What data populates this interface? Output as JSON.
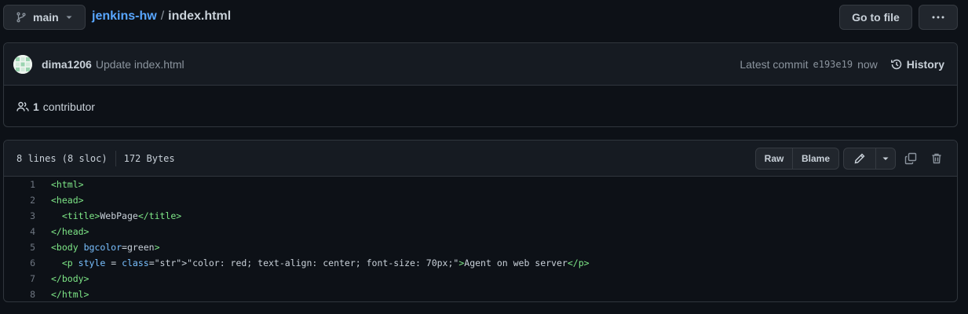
{
  "branch": {
    "name": "main"
  },
  "breadcrumb": {
    "repo": "jenkins-hw",
    "separator": "/",
    "file": "index.html"
  },
  "top_actions": {
    "goto_file": "Go to file",
    "more": "···"
  },
  "commit": {
    "author": "dima1206",
    "message": "Update index.html",
    "latest_label": "Latest commit",
    "sha": "e193e19",
    "time": "now",
    "history_label": "History"
  },
  "contributors": {
    "count": "1",
    "label": "contributor"
  },
  "file": {
    "lines_info": "8 lines (8 sloc)",
    "size": "172 Bytes",
    "raw_label": "Raw",
    "blame_label": "Blame"
  },
  "code_lines": [
    {
      "num": "1",
      "text": "<html>"
    },
    {
      "num": "2",
      "text": "<head>"
    },
    {
      "num": "3",
      "text": "  <title>WebPage</title>"
    },
    {
      "num": "4",
      "text": "</head>"
    },
    {
      "num": "5",
      "text": "<body bgcolor=green>"
    },
    {
      "num": "6",
      "text": "  <p style = \"color: red; text-align: center; font-size: 70px;\">Agent on web server</p>"
    },
    {
      "num": "7",
      "text": "</body>"
    },
    {
      "num": "8",
      "text": "</html>"
    }
  ],
  "colors": {
    "background": "#0d1117",
    "link": "#58a6ff",
    "tag": "#7ee787",
    "attribute": "#79c0ff",
    "string": "#a5d6ff"
  }
}
